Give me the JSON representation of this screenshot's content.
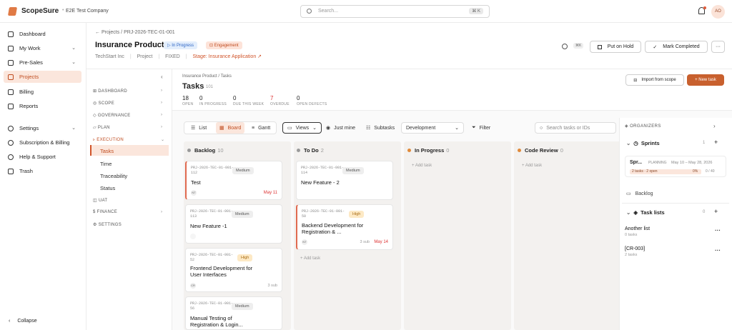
{
  "app": {
    "brand": "ScopeSure",
    "company": "E2E Test Company",
    "user_initials": "AO"
  },
  "search": {
    "placeholder": "Search...",
    "shortcut": "⌘ K"
  },
  "sidebar": {
    "items": [
      {
        "label": "Dashboard",
        "icon": "grid-icon"
      },
      {
        "label": "My Work",
        "icon": "briefcase-icon",
        "chevron": "⌄"
      },
      {
        "label": "Pre-Sales",
        "icon": "store-icon",
        "chevron": "⌄"
      },
      {
        "label": "Projects",
        "icon": "folder-icon",
        "active": true
      },
      {
        "label": "Billing",
        "icon": "receipt-icon"
      },
      {
        "label": "Reports",
        "icon": "chart-icon"
      },
      {
        "label": "Settings",
        "icon": "gear-icon",
        "chevron": "⌄"
      },
      {
        "label": "Subscription & Billing",
        "icon": "card-icon"
      },
      {
        "label": "Help & Support",
        "icon": "help-icon"
      },
      {
        "label": "Trash",
        "icon": "trash-icon"
      }
    ],
    "collapse_label": "Collapse"
  },
  "header": {
    "breadcrumb": "← Projects  /  PRJ-2026-TEC-01-001",
    "title": "Insurance Product",
    "status_badge": "▷ In Progress",
    "type_badge": "⊡ Engagement",
    "meta": {
      "client": "TechStart Inc",
      "kind": "Project",
      "pricing": "FIXED",
      "stage": "Stage: Insurance Application ↗"
    },
    "shortcut": "⌘K",
    "put_on_hold": "Put on Hold",
    "mark_completed": "Mark Completed",
    "more": "···"
  },
  "subnav": {
    "collapse": "‹",
    "sections": [
      {
        "label": "DASHBOARD",
        "chev": "›"
      },
      {
        "label": "SCOPE",
        "chev": "›"
      },
      {
        "label": "GOVERNANCE",
        "chev": "›"
      },
      {
        "label": "PLAN",
        "chev": "›"
      },
      {
        "label": "EXECUTION",
        "chev": "⌄"
      }
    ],
    "execution_items": [
      "Tasks",
      "Time",
      "Traceability",
      "Status"
    ],
    "after": [
      {
        "label": "UAT",
        "chev": ""
      },
      {
        "label": "FINANCE",
        "chev": "›"
      },
      {
        "label": "SETTINGS",
        "chev": ""
      }
    ]
  },
  "tasks": {
    "breadcrumb": "Insurance Product  /  Tasks",
    "title": "Tasks",
    "count": "101",
    "import_label": "Import from scope",
    "new_task_label": "+ New task",
    "stats": [
      {
        "value": "18",
        "label": "OPEN"
      },
      {
        "value": "0",
        "label": "IN PROGRESS"
      },
      {
        "value": "0",
        "label": "DUE THIS WEEK"
      },
      {
        "value": "7",
        "label": "OVERDUE"
      },
      {
        "value": "0",
        "label": "OPEN DEFECTS"
      }
    ],
    "toolbar": {
      "list": "List",
      "board": "Board",
      "gantt": "Gantt",
      "views": "Views",
      "just_mine": "Just mine",
      "subtasks": "Subtasks",
      "filter_value": "Development",
      "filter": "Filter",
      "search_placeholder": "Search tasks or IDs"
    }
  },
  "board": {
    "columns": [
      {
        "name": "Backlog",
        "count": "10",
        "color": "#9a9a9a"
      },
      {
        "name": "To Do",
        "count": "2",
        "color": "#9a9a9a"
      },
      {
        "name": "In Progress",
        "count": "0",
        "color": "#e08a3a"
      },
      {
        "name": "Code Review",
        "count": "0",
        "color": "#e08a3a"
      }
    ],
    "add_task": "+ Add task",
    "backlog_cards": [
      {
        "id": "PRJ-2026-TEC-01-001-112",
        "priority": "Medium",
        "title": "Test",
        "avatar": "NT",
        "due": "May 11"
      },
      {
        "id": "PRJ-2026-TEC-01-001-113",
        "priority": "Medium",
        "title": "New Feature -1",
        "avatar": "",
        "due": ""
      },
      {
        "id": "PRJ-2026-TEC-01-001-52",
        "priority": "High",
        "title": "Frontend Development for User Interfaces",
        "avatar": "CR",
        "sub": "3 sub"
      },
      {
        "id": "PRJ-2026-TEC-01-001-56",
        "priority": "Medium",
        "title": "Manual Testing of Registration & Login...",
        "avatar": "",
        "due": ""
      }
    ],
    "todo_cards": [
      {
        "id": "PRJ-2026-TEC-01-001-114",
        "priority": "Medium",
        "title": "New Feature - 2"
      },
      {
        "id": "PRJ-2026-TEC-01-001-50",
        "priority": "High",
        "title": "Backend Development for Registration & ...",
        "avatar": "NT",
        "sub": "3 sub",
        "due": "May 14"
      }
    ]
  },
  "organizers": {
    "title": "ORGANIZERS",
    "sprints": {
      "label": "Sprints",
      "count": "1",
      "name": "Spr...",
      "state": "PLANNING",
      "dates": "May 10 – May 28, 2026",
      "tasks": "2 tasks · 2 open",
      "pct": "0%",
      "hours": "0 / 40"
    },
    "backlog_label": "Backlog",
    "task_lists": {
      "label": "Task lists",
      "count": "0",
      "items": [
        {
          "name": "Another list",
          "count": "0 tasks"
        },
        {
          "name": "[CR-003]",
          "count": "2 tasks"
        }
      ]
    }
  },
  "colors": {
    "accent": "#d0542a",
    "active_bg": "#fbe6dc"
  }
}
